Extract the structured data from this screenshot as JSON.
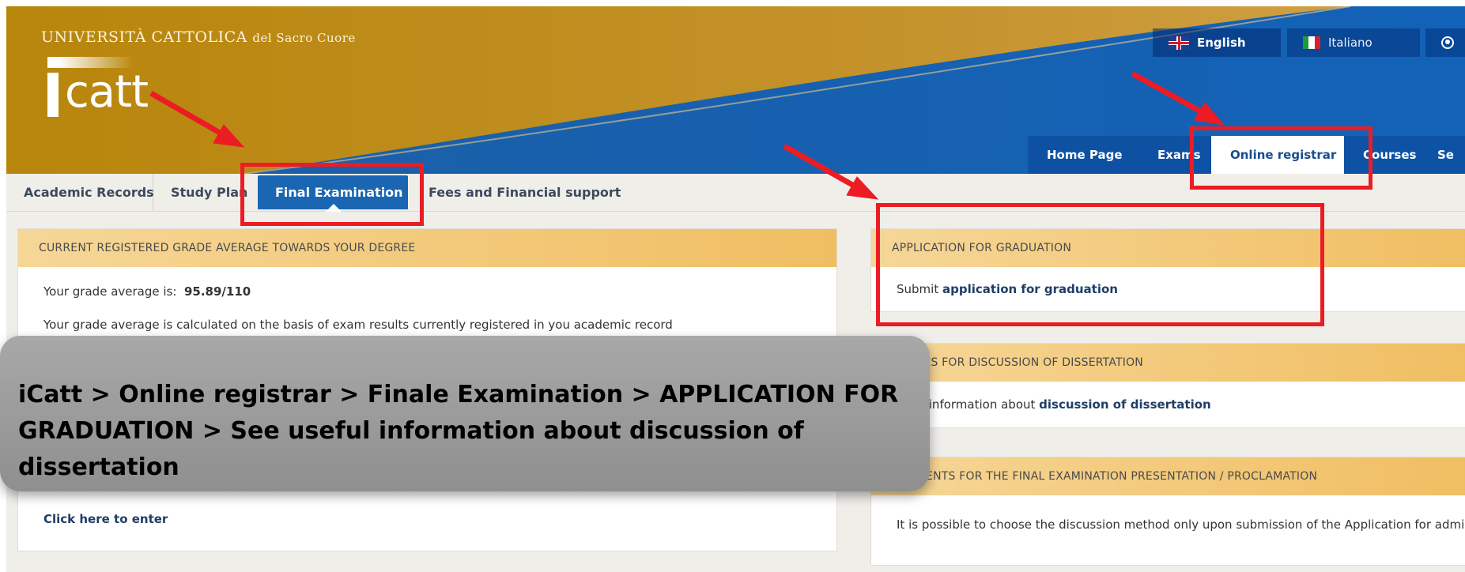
{
  "brand": {
    "university": "UNIVERSITÀ CATTOLICA",
    "university_suffix": "del Sacro Cuore",
    "logo_text": "catt"
  },
  "languages": {
    "english": "English",
    "italiano": "Italiano",
    "user_icon": "user-circle-icon"
  },
  "main_nav": [
    {
      "label": "Home Page"
    },
    {
      "label": "Exams"
    },
    {
      "label": "Online registrar"
    },
    {
      "label": "Courses"
    },
    {
      "label": "Se"
    }
  ],
  "sub_nav": [
    {
      "label": "Academic Records"
    },
    {
      "label": "Study Plan"
    },
    {
      "label": "Final Examination"
    },
    {
      "label": "Fees and Financial support"
    }
  ],
  "left_panel": {
    "title": "CURRENT REGISTERED GRADE AVERAGE TOWARDS YOUR DEGREE",
    "grade_label": "Your grade average is:",
    "grade_value": "95.89/110",
    "grade_note": "Your grade average is calculated on the basis of exam results currently registered in you academic record",
    "enter_link": "Click here to enter"
  },
  "right_panels": {
    "application": {
      "title": "APPLICATION FOR GRADUATION",
      "prefix": "Submit",
      "link": "application for graduation"
    },
    "procedures": {
      "title": "EDURES FOR DISCUSSION OF DISSERTATION",
      "prefix": "seful information about",
      "link": "discussion of dissertation"
    },
    "arrangements": {
      "title": "NGEMENTS FOR THE FINAL EXAMINATION PRESENTATION / PROCLAMATION",
      "text": "It is possible to choose the discussion method only upon submission of the Application for admis"
    }
  },
  "caption": {
    "line1": "iCatt > Online registrar > Finale Examination > APPLICATION FOR",
    "line2": "GRADUATION > See useful information about discussion of dissertation"
  },
  "colors": {
    "gold": "#b8860b",
    "blue": "#1a66b3",
    "highlight": "#ec1c24"
  }
}
